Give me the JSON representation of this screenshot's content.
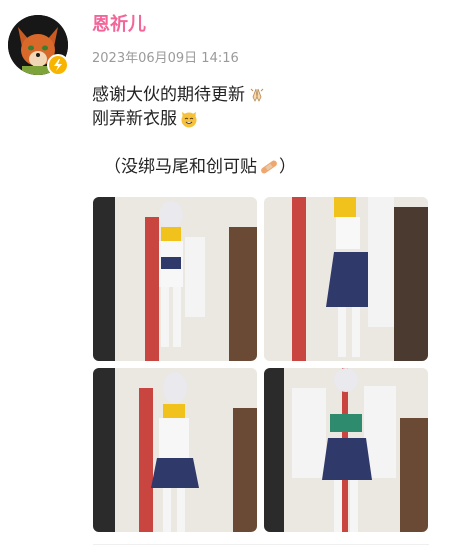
{
  "post": {
    "username": "恩祈儿",
    "timestamp": "2023年06月09日 14:16",
    "lines": [
      "感谢大伙的期待更新",
      "刚弄新衣服",
      "（没绑马尾和创可贴"
    ],
    "closing": "）"
  },
  "icons": {
    "avatar": "fox-avatar",
    "badge": "verified-lightning-icon",
    "line1_emoji": "praying-hands-emoji",
    "line2_emoji": "cat-face-emoji",
    "line3_emoji": "bandage-emoji"
  },
  "colors": {
    "username": "#f2669a",
    "timestamp": "#9a9a9a",
    "badge": "#f7b500"
  }
}
